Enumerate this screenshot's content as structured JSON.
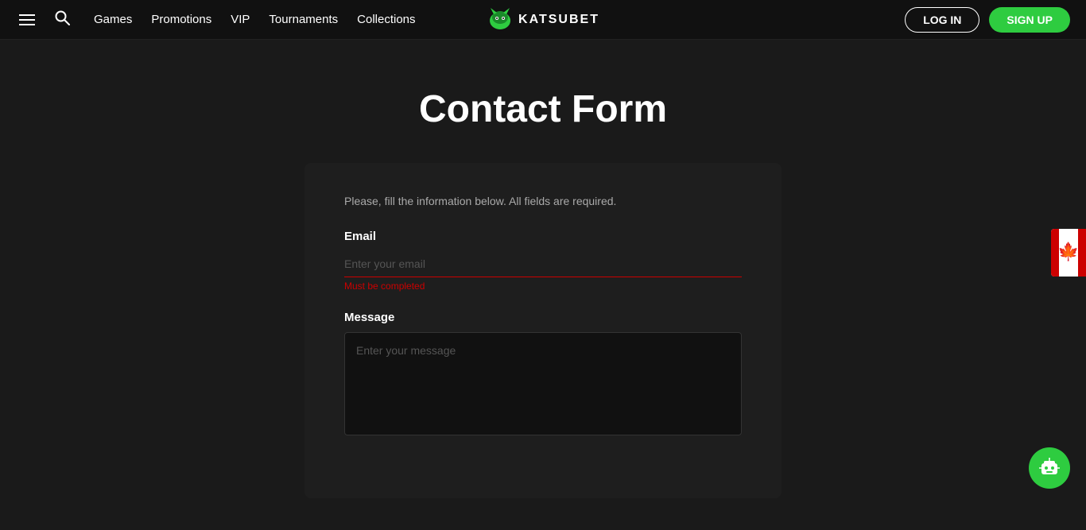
{
  "navbar": {
    "games_label": "Games",
    "promotions_label": "Promotions",
    "vip_label": "VIP",
    "tournaments_label": "Tournaments",
    "collections_label": "Collections",
    "logo_text": "KatsuBet",
    "login_label": "LOG IN",
    "signup_label": "SIGN UP"
  },
  "page": {
    "title": "Contact Form"
  },
  "form": {
    "description": "Please, fill the information below. All fields are required.",
    "email_label": "Email",
    "email_placeholder": "Enter your email",
    "email_error": "Must be completed",
    "message_label": "Message",
    "message_placeholder": "Enter your message"
  },
  "flag": {
    "country": "Canada",
    "aria": "canada-flag"
  },
  "chatbot": {
    "label": "Chat Support"
  }
}
